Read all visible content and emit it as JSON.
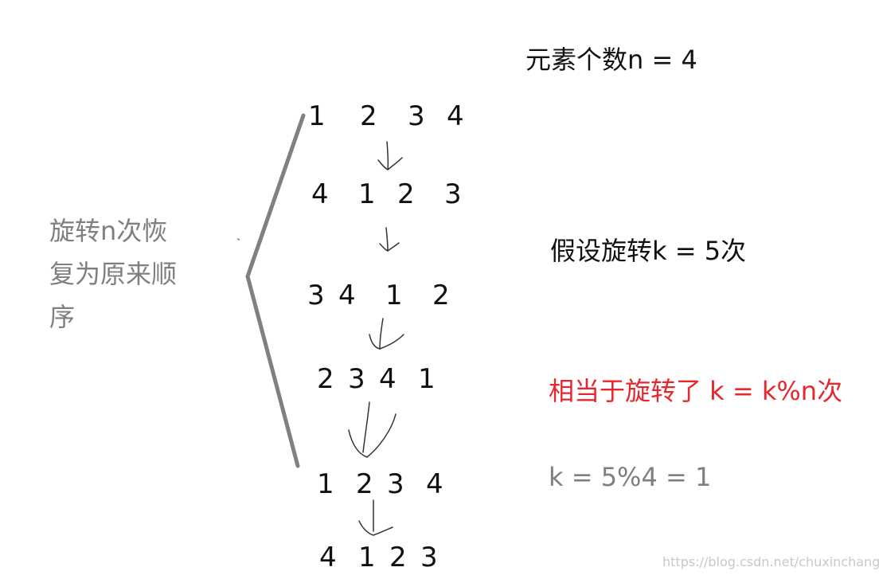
{
  "rows": [
    [
      "1",
      "2",
      "3",
      "4"
    ],
    [
      "4",
      "1",
      "2",
      "3"
    ],
    [
      "3",
      "4",
      "1",
      "2"
    ],
    [
      "2",
      "3",
      "4",
      "1"
    ],
    [
      "1",
      "2",
      "3",
      "4"
    ],
    [
      "4",
      "1",
      "2",
      "3"
    ]
  ],
  "left_label": {
    "line1": "旋转n次恢",
    "line2": "复为原来顺",
    "line3": "序"
  },
  "notes": {
    "element_count": "元素个数n = 4",
    "assume_rotate": "假设旋转k = 5次",
    "equivalent": "相当于旋转了 k = k%n次",
    "result": "k = 5%4 = 1"
  },
  "colors": {
    "text": "#111111",
    "gray": "#7f7f7f",
    "red": "#e8262d",
    "brace": "#808080"
  },
  "watermark": "https://blog.csdn.net/chuxinchangcun"
}
